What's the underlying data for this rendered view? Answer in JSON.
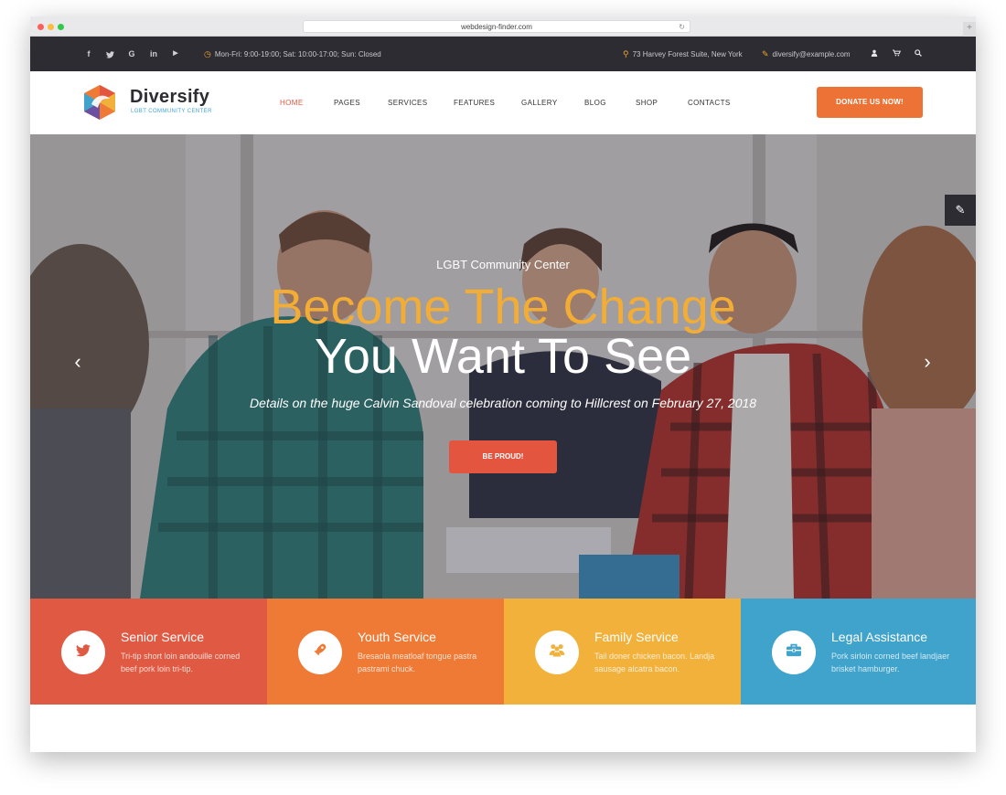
{
  "browser": {
    "url": "webdesign-finder.com",
    "reload_icon": "reload-icon",
    "new_tab_icon": "plus-icon"
  },
  "topbar": {
    "social": [
      {
        "icon": "facebook-icon",
        "glyph": "f"
      },
      {
        "icon": "twitter-icon",
        "glyph": "t"
      },
      {
        "icon": "google-icon",
        "glyph": "G"
      },
      {
        "icon": "linkedin-icon",
        "glyph": "in"
      },
      {
        "icon": "youtube-icon",
        "glyph": "▶"
      }
    ],
    "hours": "Mon-Fri: 9:00-19:00; Sat: 10:00-17:00; Sun: Closed",
    "address": "73 Harvey Forest Suite, New York",
    "email": "diversify@example.com",
    "icons": [
      "user-icon",
      "cart-icon",
      "search-icon"
    ]
  },
  "header": {
    "brand": "Diversify",
    "tagline": "LGBT COMMUNITY CENTER",
    "nav": [
      "HOME",
      "PAGES",
      "SERVICES",
      "FEATURES",
      "GALLERY",
      "BLOG",
      "SHOP",
      "CONTACTS"
    ],
    "active_nav": "HOME",
    "donate_label": "DONATE US NOW!"
  },
  "hero": {
    "eyebrow": "LGBT Community Center",
    "title_line1": "Become The Change",
    "title_line2": "You Want To See",
    "subtitle": "Details on the huge Calvin Sandoval celebration coming to Hillcrest on February 27, 2018",
    "button_label": "BE PROUD!",
    "prev_icon": "chevron-left-icon",
    "next_icon": "chevron-right-icon",
    "edit_icon": "pencil-icon"
  },
  "services": [
    {
      "title": "Senior Service",
      "desc": "Tri-tip short loin andouille corned beef pork loin tri-tip.",
      "icon": "twitter-bird-icon",
      "color": "#e05a43"
    },
    {
      "title": "Youth Service",
      "desc": "Bresaola meatloaf tongue pastra pastrami chuck.",
      "icon": "rocket-icon",
      "color": "#ee7a35"
    },
    {
      "title": "Family Service",
      "desc": "Tail doner chicken bacon. Landja sausage alcatra bacon.",
      "icon": "group-icon",
      "color": "#f1b13b"
    },
    {
      "title": "Legal Assistance",
      "desc": "Pork sirloin corned beef landjaer brisket hamburger.",
      "icon": "briefcase-icon",
      "color": "#3fa3cc"
    }
  ],
  "colors": {
    "accent_orange": "#ec7236",
    "accent_red": "#e4553f",
    "accent_yellow": "#f3ac34",
    "dark": "#2d2c33",
    "blue": "#3da5d9"
  }
}
